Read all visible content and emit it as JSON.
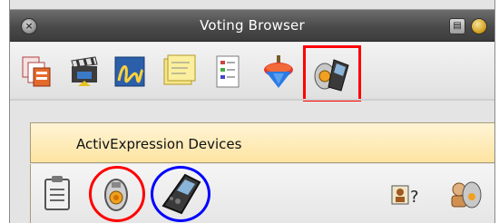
{
  "window": {
    "title": "Voting Browser"
  },
  "toolbar": {
    "tools": [
      {
        "icon": "pages-icon"
      },
      {
        "icon": "clapperboard-icon"
      },
      {
        "icon": "signature-icon"
      },
      {
        "icon": "sticky-notes-icon"
      },
      {
        "icon": "document-list-icon"
      },
      {
        "icon": "spinning-top-icon"
      },
      {
        "icon": "voting-device-icon",
        "selected": true
      }
    ]
  },
  "panel": {
    "header": "ActivExpression Devices"
  },
  "devices": [
    {
      "icon": "clipboard-icon"
    },
    {
      "icon": "activote-device-icon",
      "highlight": "#ff0000"
    },
    {
      "icon": "activexpression-device-icon",
      "highlight": "#0000ff"
    },
    {
      "icon": "assign-learner-icon"
    },
    {
      "icon": "learners-icon"
    }
  ]
}
